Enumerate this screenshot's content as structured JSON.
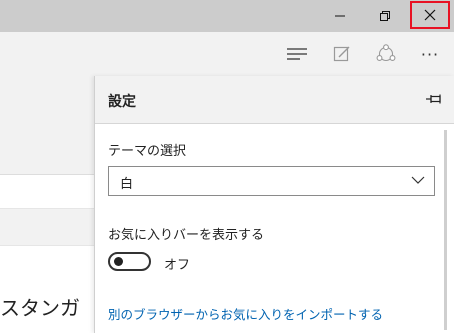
{
  "titlebar": {
    "buttons": [
      {
        "name": "minimize",
        "glyph": "—"
      },
      {
        "name": "restore",
        "glyph": "❐"
      },
      {
        "name": "close",
        "glyph": "✕"
      }
    ],
    "highlight_color": "#e81123"
  },
  "toolbar": {
    "icons": [
      "hub-icon",
      "web-note-icon",
      "share-icon",
      "more-icon"
    ],
    "more_glyph": "···"
  },
  "page": {
    "visible_text": "スタンガ"
  },
  "settings": {
    "title": "設定",
    "theme_label": "テーマの選択",
    "theme_value": "白",
    "favorites_bar_label": "お気に入りバーを表示する",
    "favorites_bar_state": "オフ",
    "import_link": "別のブラウザーからお気に入りをインポートする"
  },
  "colors": {
    "titlebar_bg": "#cccccc",
    "toolbar_bg": "#f2f2f2",
    "link": "#0063b1"
  }
}
